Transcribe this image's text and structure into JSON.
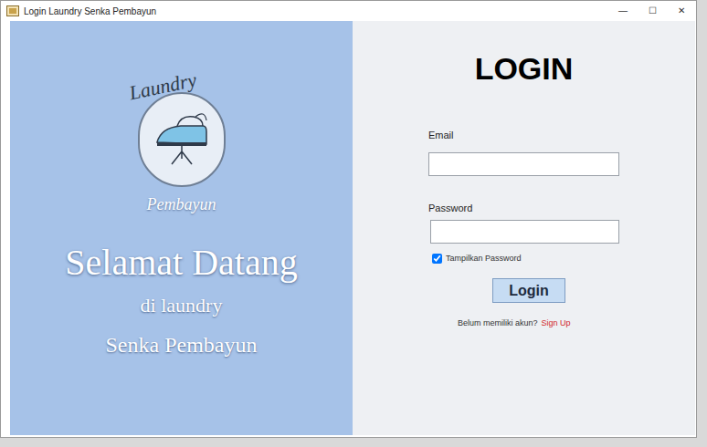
{
  "window": {
    "title": "Login Laundry Senka Pembayun",
    "controls": [
      "—",
      "☐",
      "✕"
    ]
  },
  "brand": {
    "script_title": "Laundry",
    "subtitle": "Pembayun"
  },
  "welcome": {
    "heading": "Selamat Datang",
    "line1": "di laundry",
    "line2": "Senka Pembayun"
  },
  "form": {
    "title": "LOGIN",
    "email": {
      "label": "Email"
    },
    "password": {
      "label": "Password"
    },
    "show_password": {
      "label": "Tampilkan Password",
      "checked": true
    },
    "submit": "Login",
    "signup_prompt": "Belum memiliki akun?",
    "signup_link": "Sign Up"
  }
}
